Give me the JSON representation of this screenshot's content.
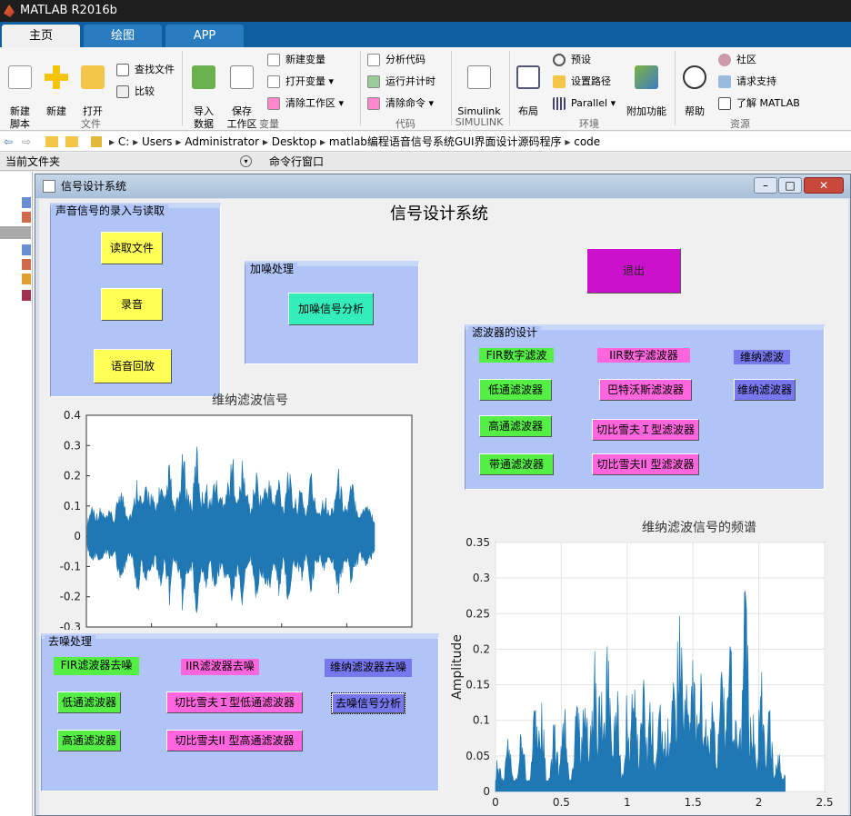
{
  "app": {
    "title": "MATLAB R2016b"
  },
  "tabs": [
    "主页",
    "绘图",
    "APP"
  ],
  "ribbon": {
    "new_script": "新建\n脚本",
    "new": "新建",
    "open": "打开",
    "find_files": "查找文件",
    "compare": "比较",
    "import_data": "导入\n数据",
    "save_workspace": "保存\n工作区",
    "new_variable": "新建变量",
    "open_variable": "打开变量",
    "clear_workspace": "清除工作区",
    "analyze_code": "分析代码",
    "run_and_time": "运行并计时",
    "clear_commands": "清除命令",
    "simulink": "Simulink",
    "layout": "布局",
    "preferences": "预设",
    "set_path": "设置路径",
    "parallel": "Parallel",
    "addons": "附加功能",
    "help": "帮助",
    "community": "社区",
    "request_support": "请求支持",
    "learn_matlab": "了解 MATLAB",
    "groups": {
      "file": "文件",
      "variable": "变量",
      "code": "代码",
      "simulink": "SIMULINK",
      "environment": "环境",
      "resources": "资源"
    }
  },
  "address": {
    "path": [
      "C:",
      "Users",
      "Administrator",
      "Desktop",
      "matlab编程语音信号系统GUI界面设计源码程序",
      "code"
    ]
  },
  "panes": {
    "current_folder": "当前文件夹",
    "command_window": "命令行窗口"
  },
  "figure": {
    "window_title": "信号设计系统",
    "main_title": "信号设计系统",
    "panel_record": {
      "title": "声音信号的录入与读取",
      "read_file": "读取文件",
      "record": "录音",
      "playback": "语音回放"
    },
    "panel_noise": {
      "title": "加噪处理",
      "noise_analysis": "加噪信号分析"
    },
    "exit": "退出",
    "panel_filter": {
      "title": "滤波器的设计",
      "fir_label": "FIR数字滤波",
      "iir_label": "IIR数字滤波器",
      "wiener_label": "维纳滤波",
      "lowpass": "低通滤波器",
      "butterworth": "巴特沃斯滤波器",
      "wiener": "维纳滤波器",
      "highpass": "高通滤波器",
      "cheby1": "切比雪夫Ｉ型滤波器",
      "bandpass": "带通滤波器",
      "cheby2": "切比雪夫II 型滤波器"
    },
    "panel_denoise": {
      "title": "去噪处理",
      "fir_denoise": "FIR滤波器去噪",
      "iir_denoise": "IIR滤波器去噪",
      "wiener_denoise": "维纳滤波器去噪",
      "lowpass": "低通滤波器",
      "cheby1_lowpass": "切比雪夫Ｉ型低通滤波器",
      "denoise_analysis": "去噪信号分析",
      "highpass": "高通滤波器",
      "cheby2_highpass": "切比雪夫II 型高通滤波器"
    }
  },
  "colors": {
    "panel": "#b0c4f8",
    "yellow": "#ffff55",
    "green": "#55ee44",
    "cyan": "#33eebb",
    "magenta": "#cc11cc",
    "pink": "#ff66dd",
    "violet": "#7777ee",
    "plot": "#1f77b4"
  },
  "chart_data": [
    {
      "type": "line",
      "title": "维纳滤波信号",
      "xlabel": "",
      "ylabel": "",
      "ylim": [
        -0.3,
        0.4
      ],
      "yticks": [
        "0.4",
        "0.3",
        "0.2",
        "0.1",
        "0",
        "-0.1",
        "-0.2",
        "-0.3"
      ],
      "xticks": [],
      "description_values": {
        "baseline_amplitude": 0.05,
        "peak_amplitude": 0.33,
        "min_amplitude": -0.29
      },
      "envelope": [
        0.05,
        0.12,
        0.08,
        0.1,
        0.07,
        0.09,
        0.06,
        0.18,
        0.14,
        0.08,
        0.1,
        0.22,
        0.12,
        0.18,
        0.16,
        0.1,
        0.2,
        0.12,
        0.26,
        0.1,
        0.14,
        0.3,
        0.16,
        0.12,
        0.33,
        0.14,
        0.2,
        0.12,
        0.22,
        0.14,
        0.16,
        0.2,
        0.28,
        0.12,
        0.26,
        0.16,
        0.1,
        0.24,
        0.14,
        0.18,
        0.2,
        0.12,
        0.22,
        0.1,
        0.26,
        0.14,
        0.12,
        0.18,
        0.08,
        0.24,
        0.12,
        0.1,
        0.16,
        0.08,
        0.12,
        0.24,
        0.14,
        0.1,
        0.2,
        0.12,
        0.08,
        0.14,
        0.1,
        0.06
      ]
    },
    {
      "type": "area",
      "title": "维纳滤波信号的频谱",
      "xlabel": "",
      "ylabel": "Amplitude",
      "xlim": [
        0,
        2.5
      ],
      "ylim": [
        0,
        0.35
      ],
      "xticks": [
        "0",
        "0.5",
        "1",
        "1.5",
        "2",
        "2.5"
      ],
      "yticks": [
        "0.35",
        "0.3",
        "0.25",
        "0.2",
        "0.15",
        "0.1",
        "0.05",
        "0"
      ],
      "grid": true,
      "peaks": [
        [
          0.02,
          0.06
        ],
        [
          0.1,
          0.09
        ],
        [
          0.2,
          0.1
        ],
        [
          0.3,
          0.12
        ],
        [
          0.35,
          0.14
        ],
        [
          0.45,
          0.11
        ],
        [
          0.52,
          0.13
        ],
        [
          0.62,
          0.15
        ],
        [
          0.68,
          0.16
        ],
        [
          0.75,
          0.22
        ],
        [
          0.8,
          0.18
        ],
        [
          0.85,
          0.21
        ],
        [
          0.92,
          0.15
        ],
        [
          1.0,
          0.14
        ],
        [
          1.05,
          0.23
        ],
        [
          1.12,
          0.19
        ],
        [
          1.18,
          0.15
        ],
        [
          1.25,
          0.14
        ],
        [
          1.3,
          0.12
        ],
        [
          1.35,
          0.17
        ],
        [
          1.4,
          0.3
        ],
        [
          1.45,
          0.16
        ],
        [
          1.5,
          0.22
        ],
        [
          1.55,
          0.24
        ],
        [
          1.6,
          0.12
        ],
        [
          1.65,
          0.14
        ],
        [
          1.72,
          0.2
        ],
        [
          1.78,
          0.26
        ],
        [
          1.84,
          0.15
        ],
        [
          1.9,
          0.33
        ],
        [
          1.95,
          0.14
        ],
        [
          2.02,
          0.2
        ],
        [
          2.08,
          0.12
        ],
        [
          2.15,
          0.06
        ],
        [
          2.2,
          0.03
        ]
      ]
    }
  ]
}
